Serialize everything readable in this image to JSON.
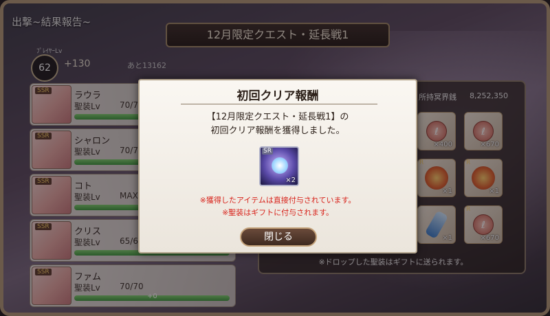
{
  "screen": {
    "title": "出撃~結果報告~",
    "quest_name": "12月限定クエスト・延長戦1"
  },
  "player": {
    "level_label": "ﾌﾟﾚｲﾔｰLv",
    "level": "62",
    "exp_gain": "+130",
    "next_exp": "あと13162"
  },
  "characters": [
    {
      "rarity": "SSR",
      "name": "ラウラ",
      "lv_label": "聖装Lv",
      "lv_value": "70/70",
      "exp_fill": 1.0
    },
    {
      "rarity": "SSR",
      "name": "シャロン",
      "lv_label": "聖装Lv",
      "lv_value": "70/70",
      "exp_fill": 1.0
    },
    {
      "rarity": "SSR",
      "name": "コト",
      "lv_label": "聖装Lv",
      "lv_value": "MAX",
      "exp_fill": 1.0
    },
    {
      "rarity": "SSR",
      "name": "クリス",
      "lv_label": "聖装Lv",
      "lv_value": "65/65",
      "exp_fill": 1.0
    },
    {
      "rarity": "SSR",
      "name": "ファム",
      "lv_label": "聖装Lv",
      "lv_value": "70/70",
      "exp_fill": 1.0,
      "exp_gain": "+0"
    }
  ],
  "drops": {
    "currency_label": "所持冥界銭",
    "currency_value": "8,252,350",
    "items": [
      {
        "type": "coin",
        "rarity": "",
        "count": "×400"
      },
      {
        "type": "coin",
        "rarity": "",
        "count": "×670"
      },
      {
        "type": "flower",
        "rarity": "R",
        "count": "×1"
      },
      {
        "type": "flower",
        "rarity": "R",
        "count": "×1"
      },
      {
        "type": "vial",
        "rarity": "",
        "count": "×1"
      },
      {
        "type": "coin",
        "rarity": "R",
        "count": "×670"
      }
    ],
    "note": "※ドロップした聖装はギフトに送られます。"
  },
  "modal": {
    "title": "初回クリア報酬",
    "message_line1": "【12月限定クエスト・延長戦1】の",
    "message_line2": "初回クリア報酬を獲得しました。",
    "reward_rarity": "SR",
    "reward_count": "×2",
    "warning1": "※獲得したアイテムは直接付与されています。",
    "warning2": "※聖装はギフトに付与されます。",
    "close_label": "閉じる"
  },
  "colors": {
    "warning": "#d8241c",
    "exp_bar": "#3e9a3e"
  }
}
